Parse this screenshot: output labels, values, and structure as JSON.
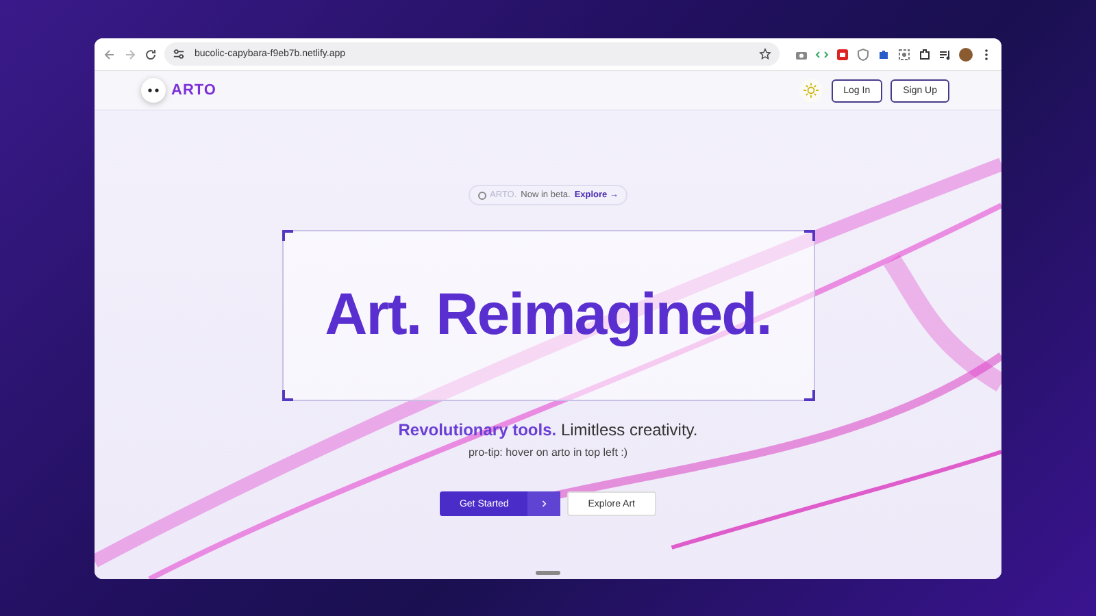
{
  "browser": {
    "url": "bucolic-capybara-f9eb7b.netlify.app"
  },
  "nav": {
    "logo": "ARTO",
    "buttons": [
      "Log In",
      "Sign Up"
    ]
  },
  "banner": {
    "brand": "ARTO.",
    "text": "Now in beta.",
    "link": "Explore →"
  },
  "hero": {
    "headline": "Art. Reimagined.",
    "tagline": "**Revolutionary tools.** Limitless creativity.",
    "tip": "pro-tip: hover on arto in top left :)"
  },
  "buttons": [
    {
      "label": "Get Started",
      "kind": "primary"
    },
    {
      "label": "Explore Art",
      "kind": "secondary"
    }
  ]
}
